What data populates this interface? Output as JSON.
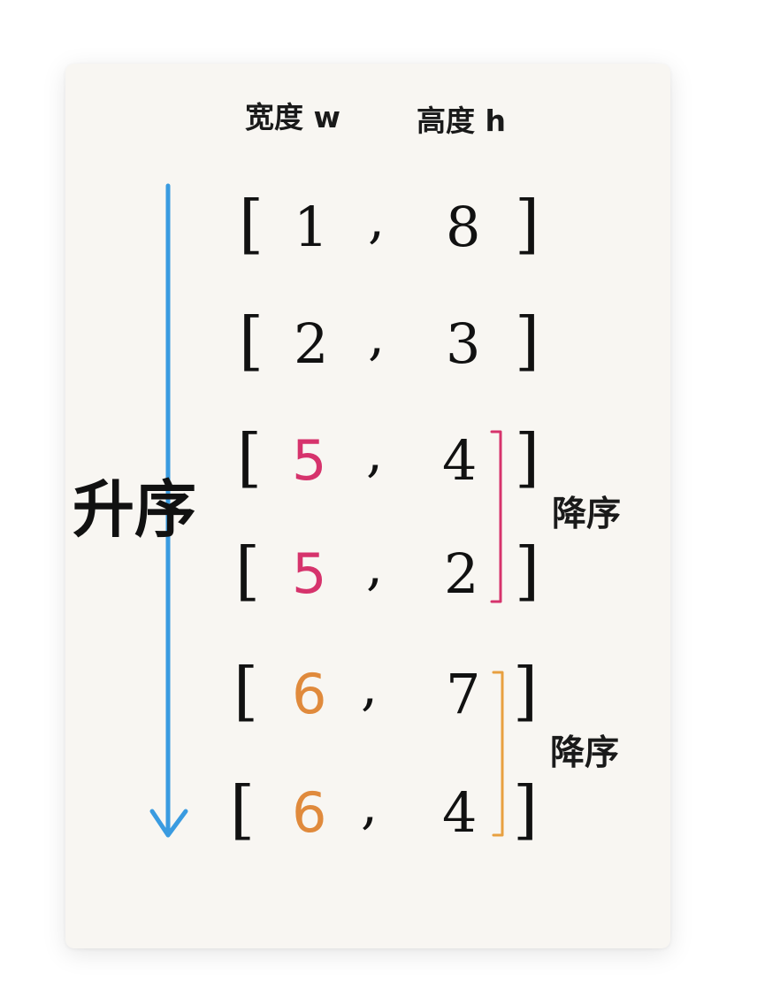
{
  "headers": {
    "width": "宽度 w",
    "height": "高度 h"
  },
  "rows": [
    {
      "w": "1",
      "h": "8",
      "w_color": "#111111"
    },
    {
      "w": "2",
      "h": "3",
      "w_color": "#111111"
    },
    {
      "w": "5",
      "h": "4",
      "w_color": "#d6336c"
    },
    {
      "w": "5",
      "h": "2",
      "w_color": "#d6336c"
    },
    {
      "w": "6",
      "h": "7",
      "w_color": "#e08a3c"
    },
    {
      "w": "6",
      "h": "4",
      "w_color": "#e08a3c"
    }
  ],
  "brackets": {
    "open": "[",
    "close": "]",
    "comma": ","
  },
  "ascending": {
    "label": "升序",
    "arrow_color": "#3a9be0"
  },
  "groups": [
    {
      "label": "降序",
      "color": "#d6336c",
      "first_row": 2,
      "last_row": 3
    },
    {
      "label": "降序",
      "color": "#e8a040",
      "first_row": 4,
      "last_row": 5
    }
  ]
}
